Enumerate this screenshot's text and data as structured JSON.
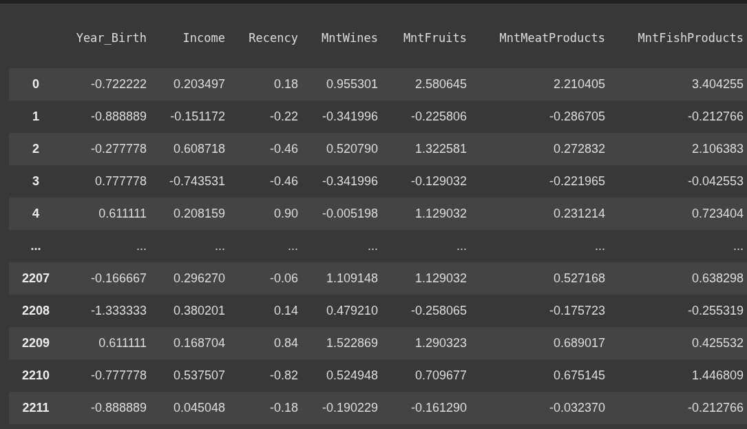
{
  "table": {
    "columns": [
      "Year_Birth",
      "Income",
      "Recency",
      "MntWines",
      "MntFruits",
      "MntMeatProducts",
      "MntFishProducts"
    ],
    "rows": [
      {
        "index": "0",
        "cells": [
          "-0.722222",
          "0.203497",
          "0.18",
          "0.955301",
          "2.580645",
          "2.210405",
          "3.404255"
        ]
      },
      {
        "index": "1",
        "cells": [
          "-0.888889",
          "-0.151172",
          "-0.22",
          "-0.341996",
          "-0.225806",
          "-0.286705",
          "-0.212766"
        ]
      },
      {
        "index": "2",
        "cells": [
          "-0.277778",
          "0.608718",
          "-0.46",
          "0.520790",
          "1.322581",
          "0.272832",
          "2.106383"
        ]
      },
      {
        "index": "3",
        "cells": [
          "0.777778",
          "-0.743531",
          "-0.46",
          "-0.341996",
          "-0.129032",
          "-0.221965",
          "-0.042553"
        ]
      },
      {
        "index": "4",
        "cells": [
          "0.611111",
          "0.208159",
          "0.90",
          "-0.005198",
          "1.129032",
          "0.231214",
          "0.723404"
        ]
      },
      {
        "index": "...",
        "cells": [
          "...",
          "...",
          "...",
          "...",
          "...",
          "...",
          "..."
        ]
      },
      {
        "index": "2207",
        "cells": [
          "-0.166667",
          "0.296270",
          "-0.06",
          "1.109148",
          "1.129032",
          "0.527168",
          "0.638298"
        ]
      },
      {
        "index": "2208",
        "cells": [
          "-1.333333",
          "0.380201",
          "0.14",
          "0.479210",
          "-0.258065",
          "-0.175723",
          "-0.255319"
        ]
      },
      {
        "index": "2209",
        "cells": [
          "0.611111",
          "0.168704",
          "0.84",
          "1.522869",
          "1.290323",
          "0.689017",
          "0.425532"
        ]
      },
      {
        "index": "2210",
        "cells": [
          "-0.777778",
          "0.537507",
          "-0.82",
          "0.524948",
          "0.709677",
          "0.675145",
          "1.446809"
        ]
      },
      {
        "index": "2211",
        "cells": [
          "-0.888889",
          "0.045048",
          "-0.18",
          "-0.190229",
          "-0.161290",
          "-0.032370",
          "-0.212766"
        ]
      }
    ]
  }
}
